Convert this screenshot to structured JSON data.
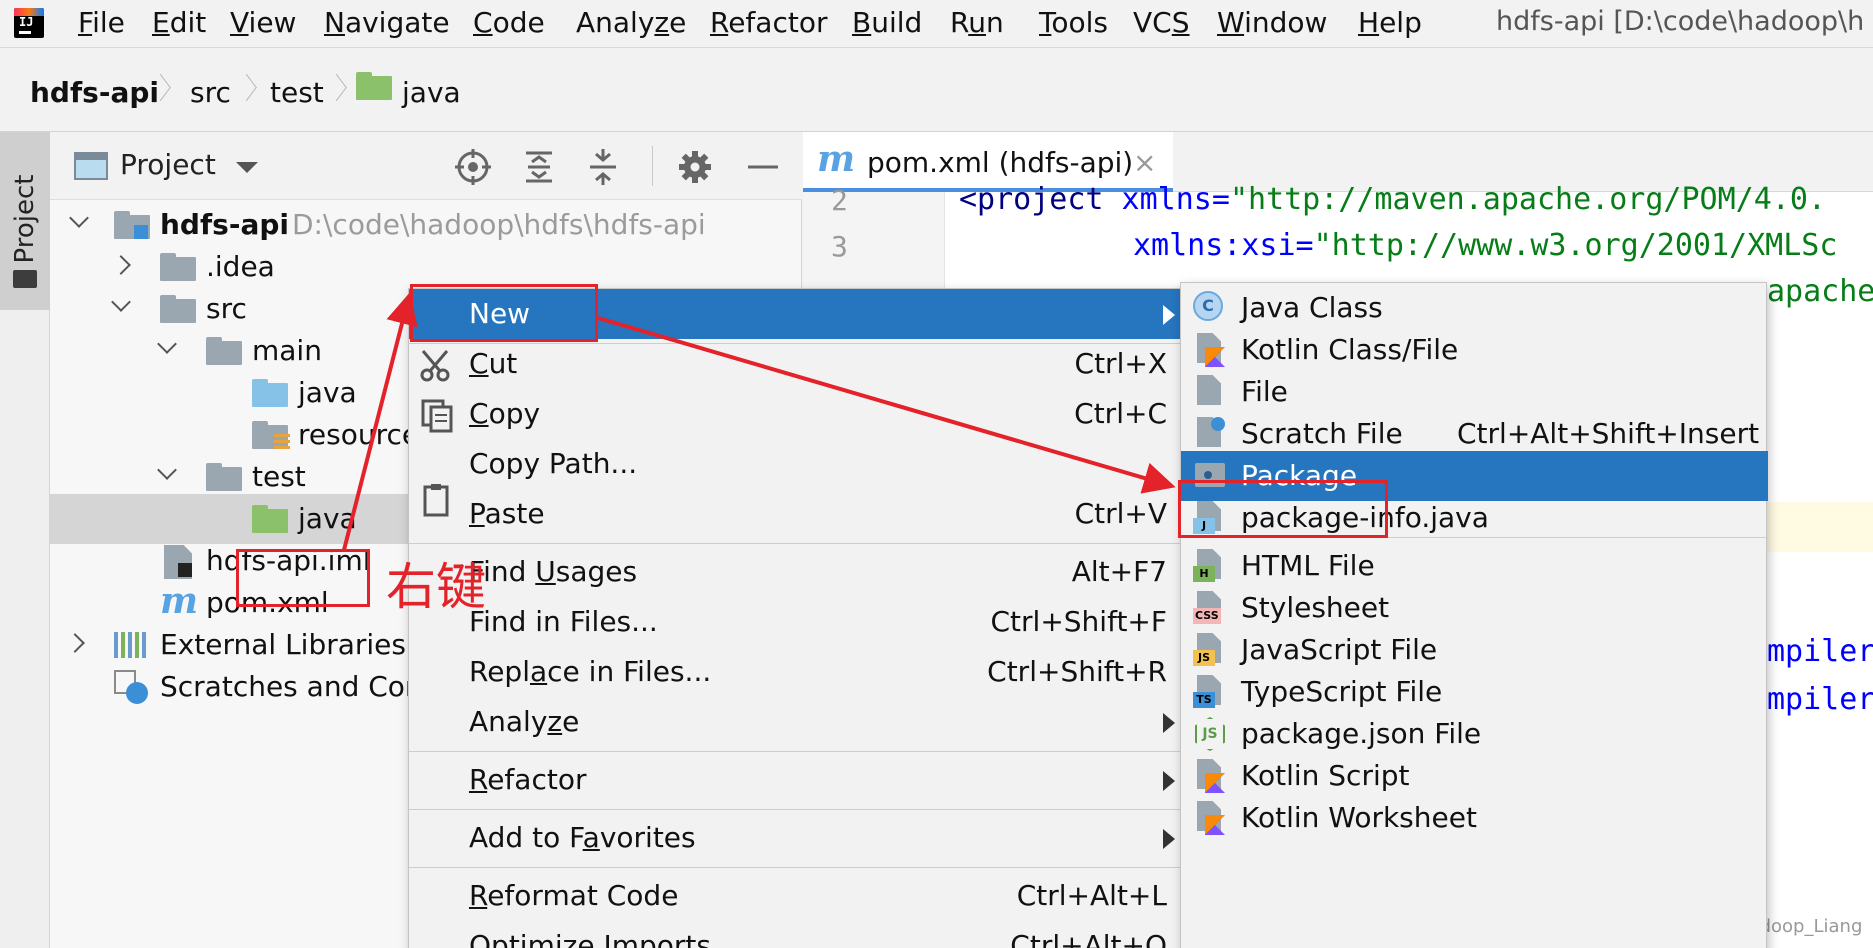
{
  "menubar": {
    "items": [
      {
        "pre": "",
        "u": "F",
        "post": "ile"
      },
      {
        "pre": "",
        "u": "E",
        "post": "dit"
      },
      {
        "pre": "",
        "u": "V",
        "post": "iew"
      },
      {
        "pre": "",
        "u": "N",
        "post": "avigate"
      },
      {
        "pre": "",
        "u": "C",
        "post": "ode"
      },
      {
        "pre": "Analy",
        "u": "z",
        "post": "e"
      },
      {
        "pre": "",
        "u": "R",
        "post": "efactor"
      },
      {
        "pre": "",
        "u": "B",
        "post": "uild"
      },
      {
        "pre": "R",
        "u": "u",
        "post": "n"
      },
      {
        "pre": "",
        "u": "T",
        "post": "ools"
      },
      {
        "pre": "VC",
        "u": "S",
        "post": ""
      },
      {
        "pre": "",
        "u": "W",
        "post": "indow"
      },
      {
        "pre": "",
        "u": "H",
        "post": "elp"
      }
    ],
    "window_title": "hdfs-api [D:\\code\\hadoop\\h"
  },
  "breadcrumb": [
    "hdfs-api",
    "src",
    "test",
    "java"
  ],
  "stripe": {
    "label": "Project"
  },
  "project_panel": {
    "title": "Project",
    "tree": [
      {
        "label": "hdfs-api",
        "path": "D:\\code\\hadoop\\hdfs\\hdfs-api"
      },
      {
        "label": ".idea"
      },
      {
        "label": "src"
      },
      {
        "label": "main"
      },
      {
        "label": "java"
      },
      {
        "label": "resource"
      },
      {
        "label": "test"
      },
      {
        "label": "java"
      },
      {
        "label": "hdfs-api.iml"
      },
      {
        "label": "pom.xml"
      },
      {
        "label": "External Libraries"
      },
      {
        "label": "Scratches and Con"
      }
    ]
  },
  "editor": {
    "tab_label": "pom.xml (hdfs-api)",
    "line_numbers": [
      "2",
      "3"
    ],
    "code": {
      "l2_tag": "<project",
      "l2_attr": " xmlns=",
      "l2_str": "\"http://maven.apache.org/POM/4.0.",
      "l3_attr": "xmlns:xsi=",
      "l3_str": "\"http://www.w3.org/2001/XMLSc",
      "frag_apache": "apache",
      "frag_mpiler_1": "mpiler",
      "frag_mpiler_2": "mpiler"
    },
    "watermark": "CSDN @Hadoop_Liang"
  },
  "context_menu": {
    "items": [
      {
        "pre": "New",
        "u": "",
        "post": "",
        "shortcut": "",
        "submenu": true
      },
      {
        "pre": "",
        "u": "C",
        "post": "ut",
        "shortcut": "Ctrl+X"
      },
      {
        "pre": "",
        "u": "C",
        "post": "opy",
        "shortcut": "Ctrl+C"
      },
      {
        "pre": "Copy Path...",
        "u": "",
        "post": "",
        "shortcut": ""
      },
      {
        "pre": "",
        "u": "P",
        "post": "aste",
        "shortcut": "Ctrl+V"
      },
      {
        "pre": "Find ",
        "u": "U",
        "post": "sages",
        "shortcut": "Alt+F7"
      },
      {
        "pre": "Find in Files...",
        "u": "",
        "post": "",
        "shortcut": "Ctrl+Shift+F"
      },
      {
        "pre": "Repl",
        "u": "a",
        "post": "ce in Files...",
        "shortcut": "Ctrl+Shift+R"
      },
      {
        "pre": "Analy",
        "u": "z",
        "post": "e",
        "shortcut": "",
        "submenu": true
      },
      {
        "pre": "",
        "u": "R",
        "post": "efactor",
        "shortcut": "",
        "submenu": true
      },
      {
        "pre": "Add to F",
        "u": "a",
        "post": "vorites",
        "shortcut": "",
        "submenu": true
      },
      {
        "pre": "",
        "u": "R",
        "post": "eformat Code",
        "shortcut": "Ctrl+Alt+L"
      },
      {
        "pre": "Optimize Imports",
        "u": "",
        "post": "",
        "shortcut": "Ctrl+Alt+O"
      }
    ]
  },
  "submenu": {
    "items": [
      {
        "label": "Java Class",
        "shortcut": "",
        "icon": "java-class-icon"
      },
      {
        "label": "Kotlin Class/File",
        "shortcut": "",
        "icon": "kotlin-file-icon"
      },
      {
        "label": "File",
        "shortcut": "",
        "icon": "file-icon"
      },
      {
        "label": "Scratch File",
        "shortcut": "Ctrl+Alt+Shift+Insert",
        "icon": "scratch-file-icon"
      },
      {
        "label": "Package",
        "shortcut": "",
        "icon": "package-icon"
      },
      {
        "label": "package-info.java",
        "shortcut": "",
        "icon": "java-file-icon"
      },
      {
        "label": "HTML File",
        "shortcut": "",
        "icon": "html-file-icon",
        "tag": "H"
      },
      {
        "label": "Stylesheet",
        "shortcut": "",
        "icon": "css-file-icon",
        "tag": "CSS"
      },
      {
        "label": "JavaScript File",
        "shortcut": "",
        "icon": "js-file-icon",
        "tag": "JS"
      },
      {
        "label": "TypeScript File",
        "shortcut": "",
        "icon": "ts-file-icon",
        "tag": "TS"
      },
      {
        "label": "package.json File",
        "shortcut": "",
        "icon": "nodejs-icon",
        "tag": "JS"
      },
      {
        "label": "Kotlin Script",
        "shortcut": "",
        "icon": "kotlin-script-icon"
      },
      {
        "label": "Kotlin Worksheet",
        "shortcut": "",
        "icon": "kotlin-worksheet-icon"
      }
    ]
  },
  "annotation": {
    "text": "右键",
    "color": "#e3222a"
  },
  "colors": {
    "selection": "#2675bf",
    "annotation": "#e3222a"
  }
}
